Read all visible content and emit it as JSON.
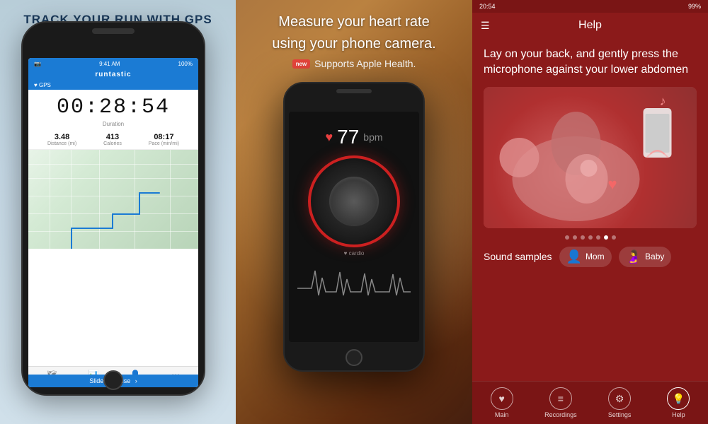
{
  "panel1": {
    "title": "TRACK YOUR RUN WITH GPS",
    "status_time": "9:41 AM",
    "status_battery": "100%",
    "app_name": "runtastic",
    "timer": "00:28:54",
    "duration_label": "Duration",
    "stats": [
      {
        "value": "3.48",
        "label": "Distance (mi)"
      },
      {
        "value": "413",
        "label": "Calories"
      },
      {
        "value": "08:17",
        "label": "Pace (min/mi)"
      }
    ],
    "slide_label": "Slide to Pause"
  },
  "panel2": {
    "title": "Measure your heart rate",
    "subtitle": "using your phone camera.",
    "badge_new": "new",
    "badge_text": "Supports Apple Health.",
    "bpm_value": "77",
    "bpm_unit": "bpm",
    "dial_label": "♥ cardio"
  },
  "panel3": {
    "status_time": "20:54",
    "status_battery": "99%",
    "page_title": "Help",
    "instruction": "Lay on your back, and gently press the microphone against your lower abdomen",
    "sound_label": "Sound samples",
    "mom_label": "Mom",
    "baby_label": "Baby",
    "nav_items": [
      {
        "icon": "♥",
        "label": "Main"
      },
      {
        "icon": "≡",
        "label": "Recordings"
      },
      {
        "icon": "⚙",
        "label": "Settings"
      },
      {
        "icon": "💡",
        "label": "Help"
      }
    ]
  }
}
